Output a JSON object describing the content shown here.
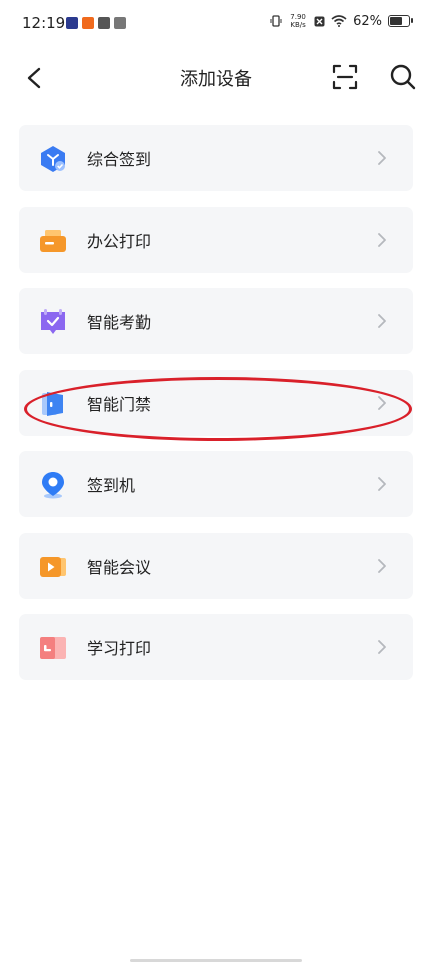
{
  "status": {
    "time": "12:19",
    "net_speed": "7.90",
    "net_unit": "KB/s",
    "battery": "62%",
    "battery_level": 0.62
  },
  "nav": {
    "title": "添加设备"
  },
  "icons": {
    "back": "chevron-left-icon",
    "scan": "scan-icon",
    "search": "search-icon"
  },
  "items": [
    {
      "label": "综合签到",
      "icon": "cube-check-icon",
      "color": "#3a7bf2"
    },
    {
      "label": "办公打印",
      "icon": "printer-icon",
      "color": "#f5972a"
    },
    {
      "label": "智能考勤",
      "icon": "attendance-icon",
      "color": "#8b67f0"
    },
    {
      "label": "智能门禁",
      "icon": "door-icon",
      "color": "#3e84f2"
    },
    {
      "label": "签到机",
      "icon": "location-pin-icon",
      "color": "#2f7cf5"
    },
    {
      "label": "智能会议",
      "icon": "video-icon",
      "color": "#f5972a"
    },
    {
      "label": "学习打印",
      "icon": "book-icon",
      "color": "#f47f7f"
    }
  ],
  "colors": {
    "highlight": "#d9202a",
    "card_bg": "#f5f6f8"
  }
}
